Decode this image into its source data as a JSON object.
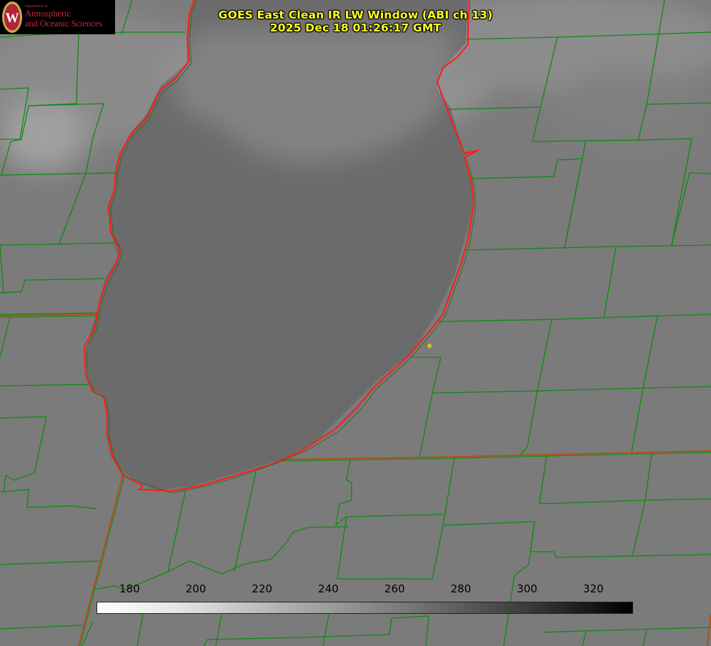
{
  "title_line1": "GOES East Clean IR LW Window (ABI ch 13)",
  "title_line2": "2025 Dec 18 01:26:17 GMT",
  "logo": {
    "small": "Department of",
    "line1": "Atmospheric",
    "line2": "and Oceanic Sciences",
    "seal_letter": "W"
  },
  "colorbar": {
    "ticks": [
      "180",
      "200",
      "220",
      "240",
      "260",
      "280",
      "300",
      "320"
    ],
    "min": 170,
    "max": 332
  },
  "colors": {
    "county_lines": "#0f8a0f",
    "shoreline": "#ff1a1a",
    "state_line": "#b0500a",
    "title": "#ffff1e",
    "marker": "#d4c61a"
  }
}
